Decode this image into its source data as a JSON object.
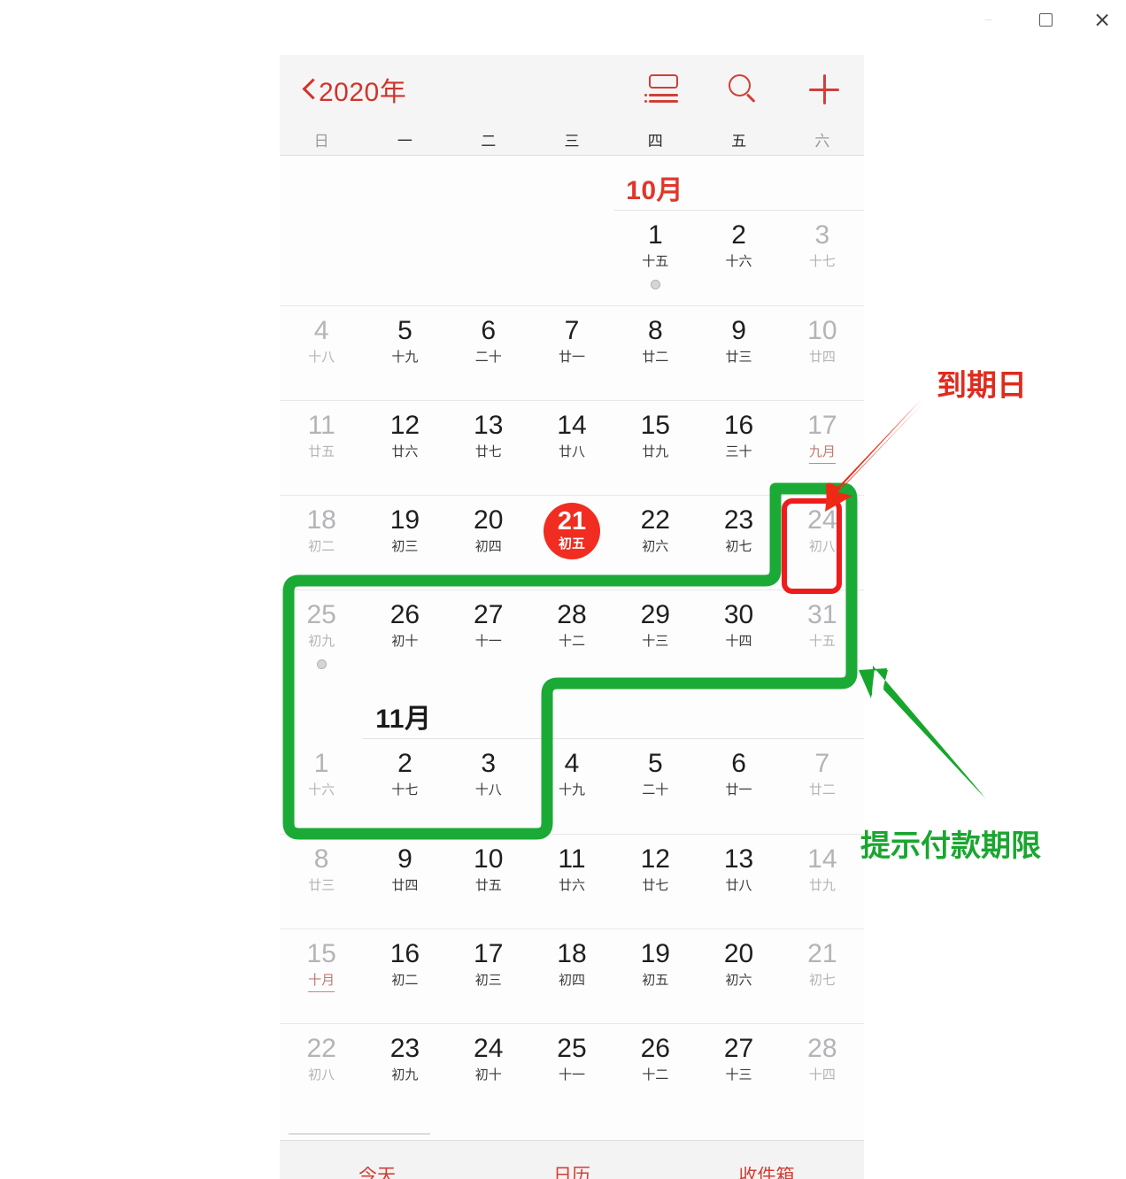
{
  "window": {
    "minimize_label": "—",
    "maximize_icon": "maximize-icon",
    "close_icon": "close-icon"
  },
  "navbar": {
    "back_label": "2020年",
    "back_icon": "chevron-left-icon",
    "list_icon": "list-view-icon",
    "search_icon": "search-icon",
    "add_icon": "plus-icon"
  },
  "weekdays": [
    {
      "label": "日",
      "dim": true
    },
    {
      "label": "一",
      "dim": false
    },
    {
      "label": "二",
      "dim": false
    },
    {
      "label": "三",
      "dim": false
    },
    {
      "label": "四",
      "dim": false
    },
    {
      "label": "五",
      "dim": false
    },
    {
      "label": "六",
      "dim": true
    }
  ],
  "months": [
    {
      "name": "10月",
      "color": "red",
      "label_col": 4,
      "weeks": [
        [
          {
            "blank": true
          },
          {
            "blank": true
          },
          {
            "blank": true
          },
          {
            "blank": true
          },
          {
            "day": "1",
            "lunar": "十五",
            "dim": false,
            "dot": true
          },
          {
            "day": "2",
            "lunar": "十六",
            "dim": false
          },
          {
            "day": "3",
            "lunar": "十七",
            "dim": true
          }
        ],
        [
          {
            "day": "4",
            "lunar": "十八",
            "dim": true
          },
          {
            "day": "5",
            "lunar": "十九",
            "dim": false
          },
          {
            "day": "6",
            "lunar": "二十",
            "dim": false
          },
          {
            "day": "7",
            "lunar": "廿一",
            "dim": false
          },
          {
            "day": "8",
            "lunar": "廿二",
            "dim": false
          },
          {
            "day": "9",
            "lunar": "廿三",
            "dim": false
          },
          {
            "day": "10",
            "lunar": "廿四",
            "dim": true
          }
        ],
        [
          {
            "day": "11",
            "lunar": "廿五",
            "dim": true
          },
          {
            "day": "12",
            "lunar": "廿六",
            "dim": false
          },
          {
            "day": "13",
            "lunar": "廿七",
            "dim": false
          },
          {
            "day": "14",
            "lunar": "廿八",
            "dim": false
          },
          {
            "day": "15",
            "lunar": "廿九",
            "dim": false
          },
          {
            "day": "16",
            "lunar": "三十",
            "dim": false
          },
          {
            "day": "17",
            "lunar": "九月",
            "dim": true,
            "festival": true
          }
        ],
        [
          {
            "day": "18",
            "lunar": "初二",
            "dim": true
          },
          {
            "day": "19",
            "lunar": "初三",
            "dim": false
          },
          {
            "day": "20",
            "lunar": "初四",
            "dim": false
          },
          {
            "day": "21",
            "lunar": "初五",
            "dim": false,
            "today": true
          },
          {
            "day": "22",
            "lunar": "初六",
            "dim": false
          },
          {
            "day": "23",
            "lunar": "初七",
            "dim": false
          },
          {
            "day": "24",
            "lunar": "初八",
            "dim": true,
            "marked": true
          }
        ],
        [
          {
            "day": "25",
            "lunar": "初九",
            "dim": true,
            "dot": true
          },
          {
            "day": "26",
            "lunar": "初十",
            "dim": false
          },
          {
            "day": "27",
            "lunar": "十一",
            "dim": false
          },
          {
            "day": "28",
            "lunar": "十二",
            "dim": false
          },
          {
            "day": "29",
            "lunar": "十三",
            "dim": false
          },
          {
            "day": "30",
            "lunar": "十四",
            "dim": false
          },
          {
            "day": "31",
            "lunar": "十五",
            "dim": true
          }
        ]
      ]
    },
    {
      "name": "11月",
      "color": "black",
      "label_col": 1,
      "weeks": [
        [
          {
            "day": "1",
            "lunar": "十六",
            "dim": true
          },
          {
            "day": "2",
            "lunar": "十七",
            "dim": false
          },
          {
            "day": "3",
            "lunar": "十八",
            "dim": false
          },
          {
            "day": "4",
            "lunar": "十九",
            "dim": false
          },
          {
            "day": "5",
            "lunar": "二十",
            "dim": false
          },
          {
            "day": "6",
            "lunar": "廿一",
            "dim": false
          },
          {
            "day": "7",
            "lunar": "廿二",
            "dim": true
          }
        ],
        [
          {
            "day": "8",
            "lunar": "廿三",
            "dim": true
          },
          {
            "day": "9",
            "lunar": "廿四",
            "dim": false
          },
          {
            "day": "10",
            "lunar": "廿五",
            "dim": false
          },
          {
            "day": "11",
            "lunar": "廿六",
            "dim": false
          },
          {
            "day": "12",
            "lunar": "廿七",
            "dim": false
          },
          {
            "day": "13",
            "lunar": "廿八",
            "dim": false
          },
          {
            "day": "14",
            "lunar": "廿九",
            "dim": true
          }
        ],
        [
          {
            "day": "15",
            "lunar": "十月",
            "dim": true,
            "festival": true
          },
          {
            "day": "16",
            "lunar": "初二",
            "dim": false
          },
          {
            "day": "17",
            "lunar": "初三",
            "dim": false
          },
          {
            "day": "18",
            "lunar": "初四",
            "dim": false
          },
          {
            "day": "19",
            "lunar": "初五",
            "dim": false
          },
          {
            "day": "20",
            "lunar": "初六",
            "dim": false
          },
          {
            "day": "21",
            "lunar": "初七",
            "dim": true
          }
        ],
        [
          {
            "day": "22",
            "lunar": "初八",
            "dim": true
          },
          {
            "day": "23",
            "lunar": "初九",
            "dim": false
          },
          {
            "day": "24",
            "lunar": "初十",
            "dim": false
          },
          {
            "day": "25",
            "lunar": "十一",
            "dim": false
          },
          {
            "day": "26",
            "lunar": "十二",
            "dim": false
          },
          {
            "day": "27",
            "lunar": "十三",
            "dim": false
          },
          {
            "day": "28",
            "lunar": "十四",
            "dim": true
          }
        ]
      ]
    }
  ],
  "tabbar": [
    {
      "label": "今天"
    },
    {
      "label": "日历"
    },
    {
      "label": "收件箱"
    }
  ],
  "annotations": [
    {
      "id": "due-date",
      "text": "到期日",
      "color": "#e02b1e",
      "kind": "red-arrow-label"
    },
    {
      "id": "payment-deadline",
      "text": "提示付款期限",
      "color": "#1aa62f",
      "kind": "green-arrow-label"
    }
  ],
  "colors": {
    "accent_red": "#cf4037",
    "today_red": "#f02d20",
    "annotation_red": "#e02b1e",
    "annotation_green": "#1aa62f",
    "marker_box_red": "#ee1c1c"
  }
}
